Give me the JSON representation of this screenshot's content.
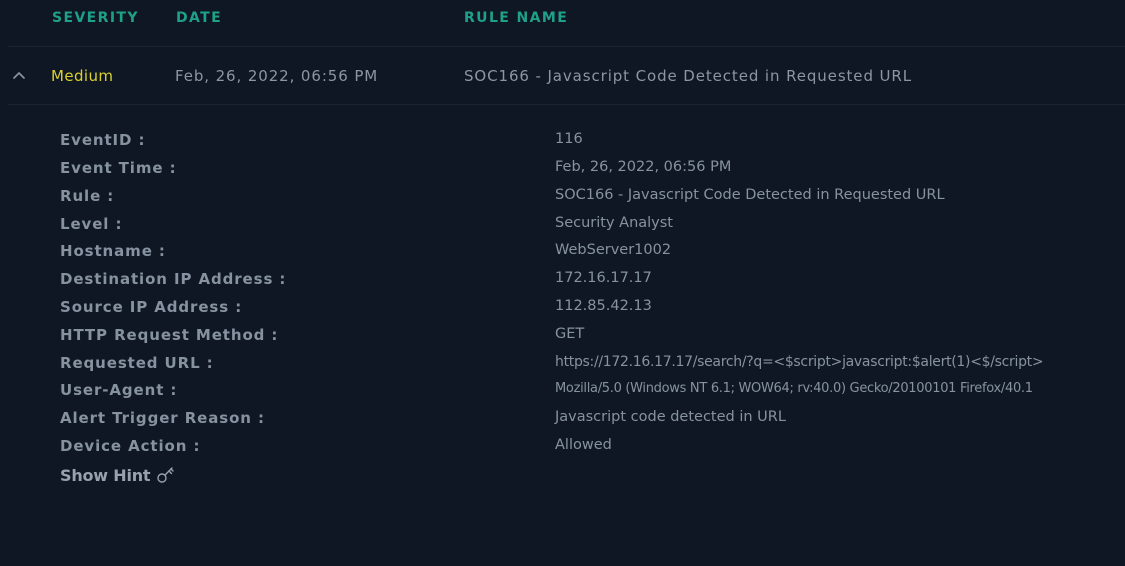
{
  "header": {
    "severity": "SEVERITY",
    "date": "DATE",
    "rule_name": "RULE NAME"
  },
  "alert": {
    "severity": "Medium",
    "date": "Feb, 26, 2022, 06:56 PM",
    "rule_name": "SOC166 - Javascript Code Detected in Requested URL",
    "expand_icon": "chevron-up-icon"
  },
  "details": [
    {
      "label": "EventID :",
      "value": "116"
    },
    {
      "label": "Event Time :",
      "value": "Feb, 26, 2022, 06:56 PM"
    },
    {
      "label": "Rule :",
      "value": "SOC166 - Javascript Code Detected in Requested URL"
    },
    {
      "label": "Level :",
      "value": "Security Analyst"
    },
    {
      "label": "Hostname :",
      "value": "WebServer1002"
    },
    {
      "label": "Destination IP Address :",
      "value": "172.16.17.17"
    },
    {
      "label": "Source IP Address :",
      "value": "112.85.42.13"
    },
    {
      "label": "HTTP Request Method :",
      "value": "GET"
    },
    {
      "label": "Requested URL :",
      "value": "https://172.16.17.17/search/?q=<$script>javascript:$alert(1)<$/script>"
    },
    {
      "label": "User-Agent :",
      "value": "Mozilla/5.0 (Windows NT 6.1; WOW64; rv:40.0) Gecko/20100101 Firefox/40.1"
    },
    {
      "label": "Alert Trigger Reason :",
      "value": "Javascript code detected in URL"
    },
    {
      "label": "Device Action :",
      "value": "Allowed"
    }
  ],
  "hint": {
    "label": "Show Hint",
    "icon": "key-icon"
  },
  "colors": {
    "background": "#0f1725",
    "header_text": "#1fa088",
    "severity_medium": "#dbd12c",
    "body_text": "#8792a0"
  }
}
